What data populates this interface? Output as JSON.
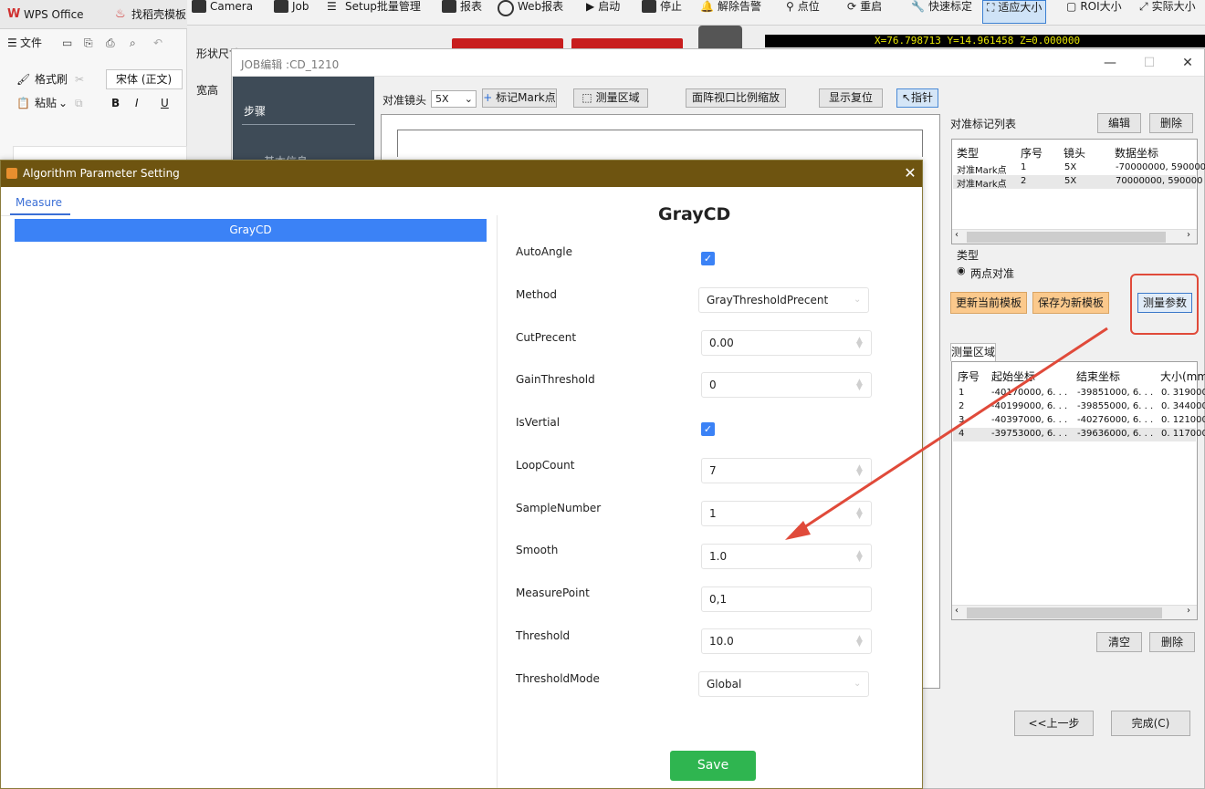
{
  "wps": {
    "tabs": [
      "WPS Office",
      "找稻壳模板"
    ],
    "file_menu": "文件",
    "format_painter": "格式刷",
    "paste": "粘贴",
    "font": "宋体 (正文)"
  },
  "toolbar": {
    "items": [
      "Camera",
      "Job",
      "Setup批量管理",
      "报表",
      "Web报表",
      "启动",
      "停止",
      "解除告警",
      "点位",
      "重启",
      "快速标定",
      "适应大小",
      "ROI大小",
      "实际大小"
    ]
  },
  "background": {
    "shape_label": "形状尺寸",
    "width_label": "宽高",
    "coord_readout": "X=76.798713 Y=14.961458 Z=0.000000"
  },
  "job_window": {
    "title": "JOB编辑 :CD_1210",
    "steps_label": "步骤",
    "steps_sub": "基本信息",
    "lens_label": "对准镜头",
    "lens_value": "5X",
    "mark_button": "标记Mark点",
    "measure_area_button": "测量区域",
    "scale_button": "面阵视口比例缩放",
    "reset_button": "显示复位",
    "pointer_button": "指针",
    "mark_list_title": "对准标记列表",
    "edit_button": "编辑",
    "delete_button": "删除",
    "mark_table": {
      "headers": [
        "类型",
        "序号",
        "镜头",
        "数据坐标"
      ],
      "rows": [
        [
          "对准Mark点",
          "1",
          "5X",
          "-70000000, 590000"
        ],
        [
          "对准Mark点",
          "2",
          "5X",
          "70000000, 590000"
        ]
      ]
    },
    "type_label": "类型",
    "type_option": "两点对准",
    "update_template_button": "更新当前模板",
    "save_template_button": "保存为新模板",
    "measure_param_button": "测量参数",
    "measure_area_tab": "测量区域",
    "area_table": {
      "headers": [
        "序号",
        "起始坐标",
        "结束坐标",
        "大小(mm"
      ],
      "rows": [
        [
          "1",
          "-40170000, 6. . .",
          "-39851000, 6. . .",
          "0. 319000"
        ],
        [
          "2",
          "-40199000, 6. . .",
          "-39855000, 6. . .",
          "0. 344000"
        ],
        [
          "3",
          "-40397000, 6. . .",
          "-40276000, 6. . .",
          "0. 121000"
        ],
        [
          "4",
          "-39753000, 6. . .",
          "-39636000, 6. . .",
          "0. 117000"
        ]
      ]
    },
    "clear_button": "清空",
    "delete2_button": "删除",
    "prev_button": "<<上一步",
    "finish_button": "完成(C)"
  },
  "dialog": {
    "title": "Algorithm Parameter Setting",
    "tab": "Measure",
    "selected_algorithm": "GrayCD",
    "heading": "GrayCD",
    "params": [
      {
        "label": "AutoAngle",
        "type": "checkbox",
        "checked": true
      },
      {
        "label": "Method",
        "type": "select",
        "value": "GrayThresholdPrecent"
      },
      {
        "label": "CutPrecent",
        "type": "number",
        "value": "0.00"
      },
      {
        "label": "GainThreshold",
        "type": "number",
        "value": "0"
      },
      {
        "label": "IsVertial",
        "type": "checkbox",
        "checked": true
      },
      {
        "label": "LoopCount",
        "type": "number",
        "value": "7"
      },
      {
        "label": "SampleNumber",
        "type": "number",
        "value": "1"
      },
      {
        "label": "Smooth",
        "type": "number",
        "value": "1.0"
      },
      {
        "label": "MeasurePoint",
        "type": "text",
        "value": "0,1"
      },
      {
        "label": "Threshold",
        "type": "number",
        "value": "10.0"
      },
      {
        "label": "ThresholdMode",
        "type": "select",
        "value": "Global"
      }
    ],
    "save_button": "Save",
    "colors": {
      "title_bar": "#6e5410",
      "accent": "#3b82f6",
      "save": "#2fb550"
    }
  },
  "annotation": {
    "color": "#e04a3a"
  }
}
